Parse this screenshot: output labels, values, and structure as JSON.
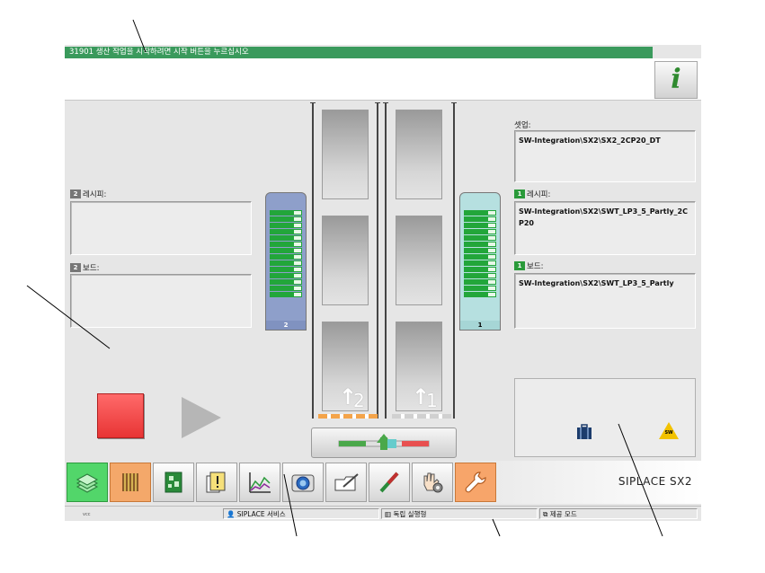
{
  "message_bar": {
    "text": "31901 생산 작업을 시작하려면 시작 버튼을 누르십시오"
  },
  "info_button": {
    "label": "i"
  },
  "left_panel": {
    "recipe_label": "레시피:",
    "recipe_value": "",
    "board_label": "보드:",
    "board_value": "",
    "lane_icon_label": "2"
  },
  "right_panel": {
    "setup_label": "셋업:",
    "setup_value": "SW-Integration\\SX2\\SX2_2CP20_DT",
    "recipe_label": "레시피:",
    "recipe_value": "SW-Integration\\SX2\\SWT_LP3_5_Partly_2CP20",
    "board_label": "보드:",
    "board_value": "SW-Integration\\SX2\\SWT_LP3_5_Partly",
    "lane_icon_label": "1"
  },
  "magazines": {
    "left_number": "2",
    "right_number": "1",
    "left_slots": 14,
    "right_slots": 14
  },
  "conveyor": {
    "lane_left_number": "2",
    "lane_right_number": "1"
  },
  "status_box": {
    "warning_text": "SW"
  },
  "toolbar": {
    "brand": "SIPLACE SX2",
    "buttons": [
      "production-icon",
      "feeder-table-icon",
      "pcb-icon",
      "documents-warning-icon",
      "statistics-chart-icon",
      "camera-icon",
      "shovel-icon",
      "nozzle-icon",
      "hand-gear-icon",
      "wrench-icon"
    ]
  },
  "statusbar": {
    "small_text": "vcc",
    "service": "SIPLACE 서비스",
    "mode": "독립 실행형",
    "board_mode": "제공 모드"
  },
  "colors": {
    "message_bar": "#3a9a5c",
    "stop": "#e83434",
    "accent_orange": "#f4a86a",
    "active_green": "#52d66a"
  }
}
